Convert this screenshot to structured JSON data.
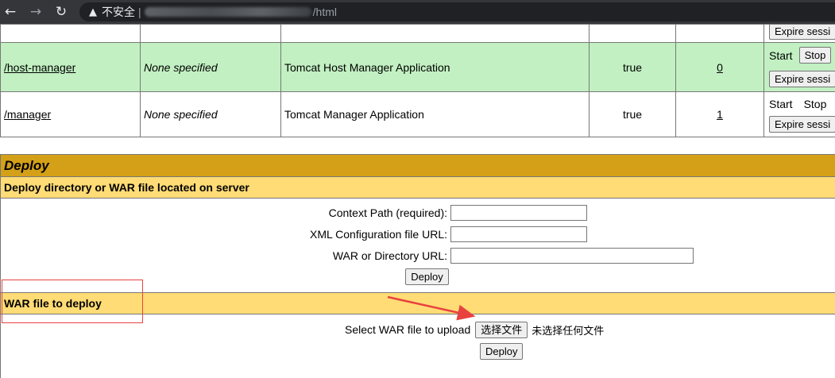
{
  "browser": {
    "back_icon": "←",
    "forward_icon": "→",
    "reload_icon": "↻",
    "warning_icon": "▲",
    "security_label": "不安全",
    "url_separator": "|",
    "url_visible": "/html"
  },
  "apps": {
    "rows": [
      {
        "path": "/host-manager",
        "version": "None specified",
        "display_name": "Tomcat Host Manager Application",
        "running": "true",
        "sessions": "0",
        "start": "Start",
        "stop": "Stop",
        "expire": "Expire sessi"
      },
      {
        "path": "/manager",
        "version": "None specified",
        "display_name": "Tomcat Manager Application",
        "running": "true",
        "sessions": "1",
        "start": "Start",
        "stop": "Stop",
        "expire": "Expire sessi"
      }
    ],
    "top_partial_expire": "Expire sessi"
  },
  "deploy": {
    "title": "Deploy",
    "server_section": {
      "title": "Deploy directory or WAR file located on server",
      "context_path_label": "Context Path (required):",
      "xml_config_label": "XML Configuration file URL:",
      "war_dir_label": "WAR or Directory URL:",
      "deploy_button": "Deploy"
    },
    "upload_section": {
      "title": "WAR file to deploy",
      "select_label": "Select WAR file to upload",
      "choose_file_button": "选择文件",
      "no_file_text": "未选择任何文件",
      "deploy_button": "Deploy"
    }
  },
  "annotation": {
    "highlight_color": "#e8423f"
  }
}
